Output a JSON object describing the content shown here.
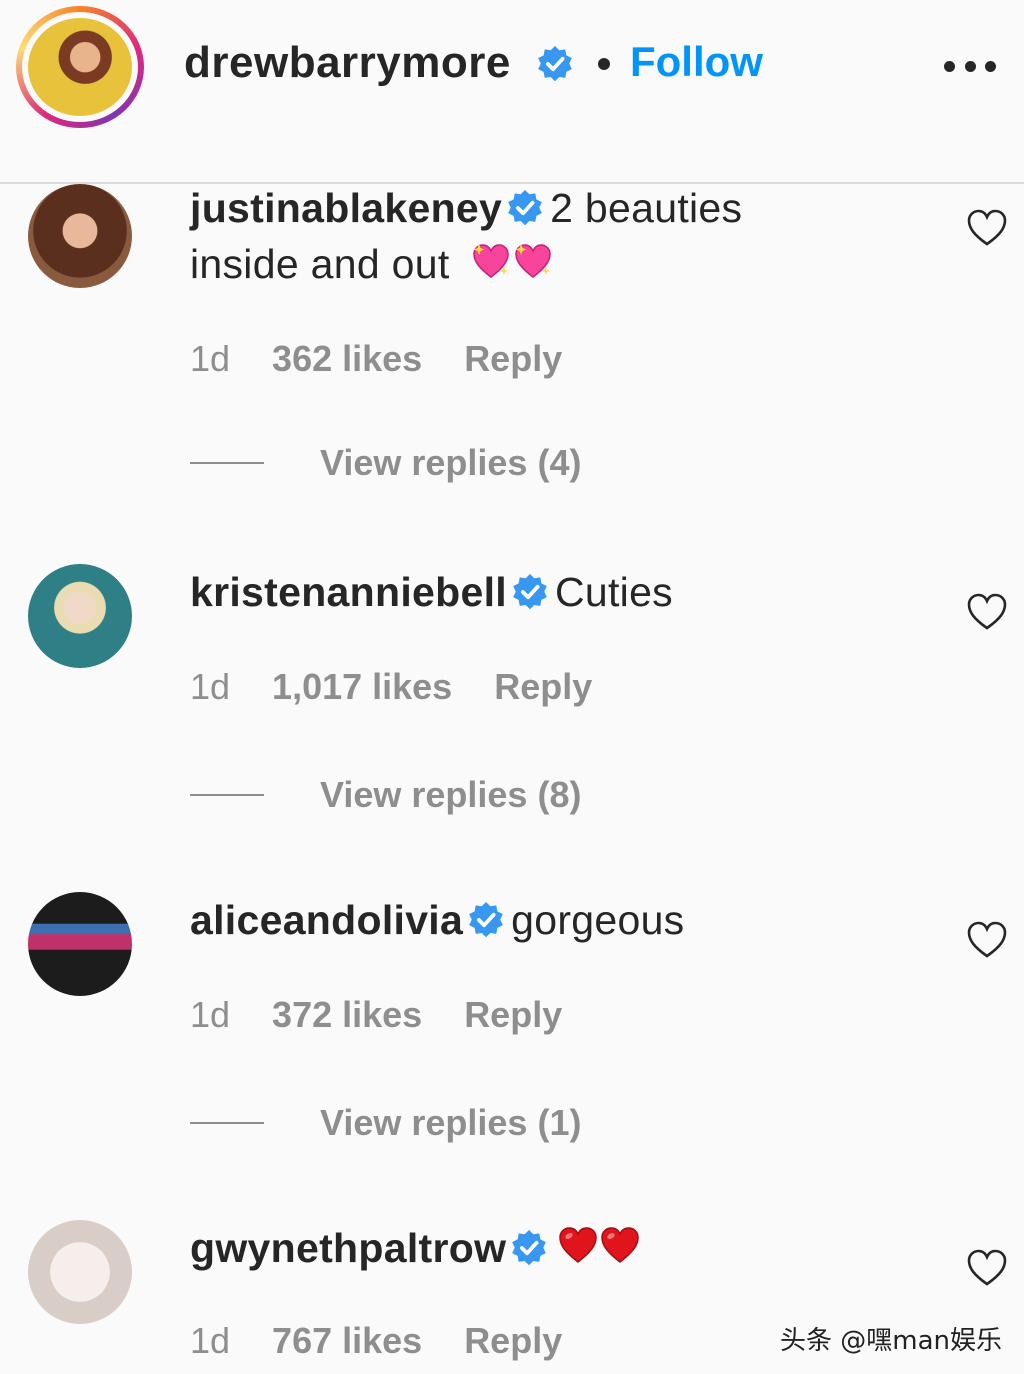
{
  "header": {
    "username": "drewbarrymore",
    "follow_label": "Follow"
  },
  "comments": [
    {
      "username": "justinablakeney",
      "text_line1": "2 beauties",
      "text_line2": "inside and out",
      "emoji": [
        "sparkling-heart",
        "sparkling-heart"
      ],
      "time": "1d",
      "likes": "362 likes",
      "reply_label": "Reply",
      "view_replies": "View replies (4)"
    },
    {
      "username": "kristenanniebell",
      "text_line1": "Cuties",
      "time": "1d",
      "likes": "1,017 likes",
      "reply_label": "Reply",
      "view_replies": "View replies (8)"
    },
    {
      "username": "aliceandolivia",
      "text_line1": "gorgeous",
      "time": "1d",
      "likes": "372 likes",
      "reply_label": "Reply",
      "view_replies": "View replies (1)"
    },
    {
      "username": "gwynethpaltrow",
      "text_line1": "",
      "emoji": [
        "red-heart",
        "red-heart"
      ],
      "time": "1d",
      "likes": "767 likes",
      "reply_label": "Reply"
    }
  ],
  "watermark": "头条 @嘿man娱乐",
  "colors": {
    "accent": "#0095f6",
    "text": "#262626",
    "secondary": "#8e8e8e",
    "verified": "#3897f0"
  }
}
